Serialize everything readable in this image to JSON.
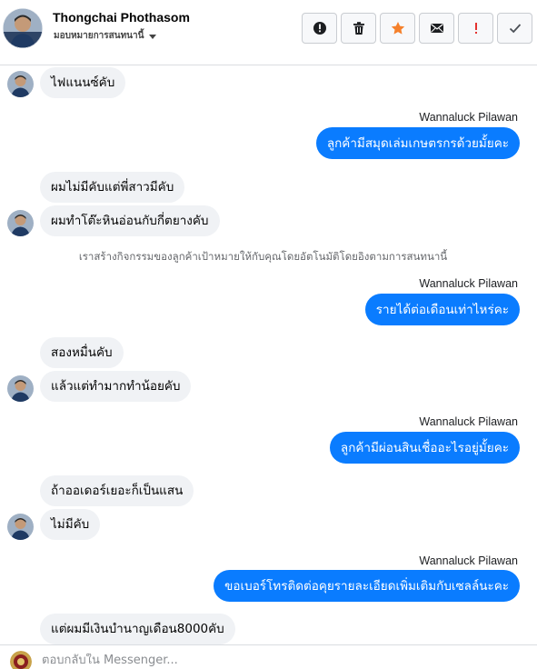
{
  "header": {
    "contact_name": "Thongchai Phothasom",
    "assign_label": "มอบหมายการสนทนานี้",
    "actions": [
      {
        "icon": "alert-circle-icon",
        "name": "mark-spam-button"
      },
      {
        "icon": "trash-icon",
        "name": "delete-button"
      },
      {
        "icon": "star-icon",
        "name": "star-button"
      },
      {
        "icon": "envelope-icon",
        "name": "mark-unread-button"
      },
      {
        "icon": "exclamation-icon",
        "name": "follow-up-button"
      },
      {
        "icon": "check-icon",
        "name": "mark-done-button"
      }
    ]
  },
  "colors": {
    "outgoing_bubble": "#0a7cff",
    "incoming_bubble": "#f0f2f5",
    "star": "#f5802b",
    "follow_up": "#e4312f"
  },
  "thread": {
    "messages": [
      {
        "text": "ไฟแนนซ์คับ"
      },
      {
        "sender": "Wannaluck Pilawan",
        "text": "ลูกค้ามีสมุดเล่มเกษตรกรด้วยมั้ยคะ"
      },
      {
        "text": "ผมไม่มีคับแต่พี่สาวมีคับ"
      },
      {
        "text": "ผมทำโต๊ะหินอ่อนกับกี่ตยางคับ"
      },
      {
        "system": "เราสร้างกิจกรรมของลูกค้าเป้าหมายให้กับคุณโดยอัตโนมัติโดยอิงตามการสนทนานี้"
      },
      {
        "sender": "Wannaluck Pilawan",
        "text": "รายได้ต่อเดือนเท่าไหร่คะ"
      },
      {
        "text": "สองหมื่นคับ"
      },
      {
        "text": "แล้วแต่ทำมากทำน้อยคับ"
      },
      {
        "sender": "Wannaluck Pilawan",
        "text": "ลูกค้ามีผ่อนสินเชื่ออะไรอยู่มั้ยคะ"
      },
      {
        "text": "ถ้าออเดอร์เยอะก็เป็นแสน"
      },
      {
        "text": "ไม่มีคับ"
      },
      {
        "sender": "Wannaluck Pilawan",
        "text": "ขอเบอร์โทรติดต่อคุยรายละเอียดเพิ่มเติมกับเซลล์นะคะ"
      },
      {
        "text": "แต่ผมมีเงินบำนาญเดือน8000คับ"
      }
    ]
  },
  "composer": {
    "placeholder": "ตอบกลับใน Messenger..."
  }
}
